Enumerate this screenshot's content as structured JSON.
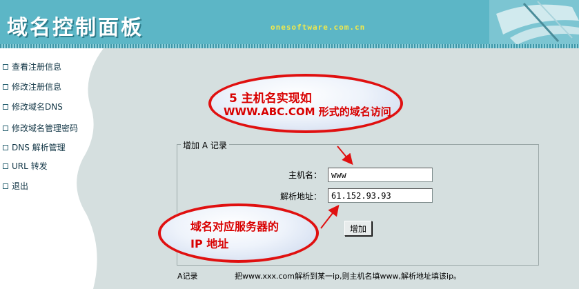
{
  "header": {
    "title": "域名控制面板",
    "site": "onesoftware.com.cn"
  },
  "sidebar": {
    "items": [
      {
        "label": "查看注册信息"
      },
      {
        "label": "修改注册信息"
      },
      {
        "label": "修改域名DNS"
      },
      {
        "label": "修改域名管理密码"
      },
      {
        "label": "DNS 解析管理"
      },
      {
        "label": "URL 转发"
      },
      {
        "label": "退出"
      }
    ]
  },
  "form": {
    "legend": "增加 A 记录",
    "host_label": "主机名：",
    "host_value": "www",
    "ip_label": "解析地址：",
    "ip_value": "61.152.93.93",
    "submit_label": "增加"
  },
  "notes": {
    "a_record_label": "A记录",
    "a_record_text": "把www.xxx.com解析到某一ip,则主机名填www,解析地址填该ip。"
  },
  "callouts": {
    "top_line1": "5  主机名实现如",
    "top_line2": "WWW.ABC.COM 形式的域名访问",
    "bottom_line1": "域名对应服务器的",
    "bottom_line2": "IP 地址"
  },
  "colors": {
    "header": "#5cb6c6",
    "callout_border": "#e01010",
    "callout_text": "#d80000",
    "background": "#d5dfdf"
  }
}
